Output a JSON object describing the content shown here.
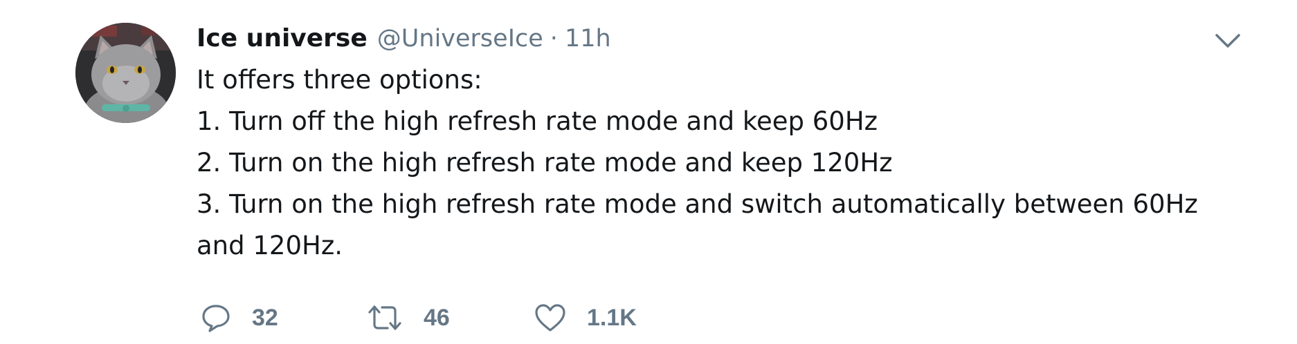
{
  "tweet": {
    "author_name": "Ice universe",
    "handle": "@UniverseIce",
    "separator": "·",
    "time": "11h",
    "lines": [
      "It offers three options:",
      "1. Turn off the high refresh rate mode and keep 60Hz",
      "2. Turn on the high refresh rate mode and keep 120Hz",
      "3. Turn on the high refresh rate mode and switch automatically between 60Hz",
      "and 120Hz."
    ]
  },
  "actions": {
    "reply_count": "32",
    "retweet_count": "46",
    "like_count": "1.1K"
  },
  "icons": {
    "avatar": "cat-avatar",
    "menu": "chevron-down-icon",
    "reply": "reply-icon",
    "retweet": "retweet-icon",
    "like": "heart-icon"
  },
  "colors": {
    "text": "#14171a",
    "secondary": "#657786"
  }
}
